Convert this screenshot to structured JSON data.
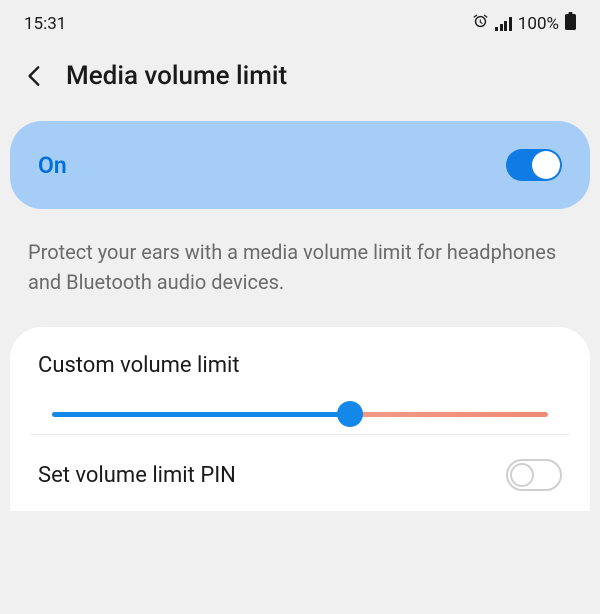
{
  "status": {
    "time": "15:31",
    "battery_percent": "100%"
  },
  "header": {
    "title": "Media volume limit"
  },
  "toggle": {
    "label": "On",
    "enabled": true
  },
  "description": "Protect your ears with a media volume limit for headphones and Bluetooth audio devices.",
  "custom_limit": {
    "title": "Custom volume limit",
    "value_percent": 60
  },
  "pin": {
    "title": "Set volume limit PIN",
    "enabled": false
  }
}
